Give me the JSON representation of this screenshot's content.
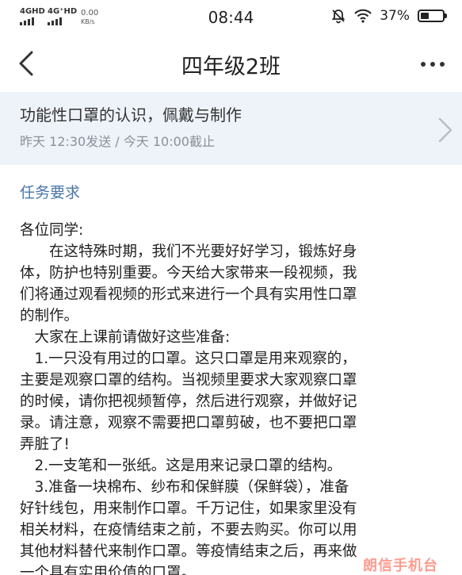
{
  "status_bar": {
    "signal1_label": "4GHD",
    "signal2_label": "4G⁺HD",
    "net_speed_value": "0.00",
    "net_speed_unit": "KB/s",
    "time": "08:44",
    "battery_percent": "37%",
    "battery_level": 0.37
  },
  "nav": {
    "title": "四年级2班"
  },
  "assignment": {
    "title": "功能性口罩的认识，佩戴与制作",
    "time_info": "昨天 12:30发送 / 今天 10:00截止"
  },
  "content": {
    "section_heading": "任务要求",
    "lines": [
      "各位同学:",
      "　　在这特殊时期，我们不光要好好学习，锻炼好身",
      "体，防护也特别重要。今天给大家带来一段视频，我",
      "们将通过观看视频的形式来进行一个具有实用性口罩",
      "的制作。",
      "　大家在上课前请做好这些准备:",
      "　1.一只没有用过的口罩。这只口罩是用来观察的，",
      "主要是观察口罩的结构。当视频里要求大家观察口罩",
      "的时候，请你把视频暂停，然后进行观察，并做好记",
      "录。请注意，观察不需要把口罩剪破，也不要把口罩",
      "弄脏了!",
      "　2.一支笔和一张纸。这是用来记录口罩的结构。",
      "　3.准备一块棉布、纱布和保鲜膜（保鲜袋），准备",
      "好针线包，用来制作口罩。千万记住，如果家里没有",
      "相关材料，在疫情结束之前，不要去购买。你可以用",
      "其他材料替代来制作口罩。等疫情结束之后，再来做",
      "一个具有实用价值的口罩。"
    ]
  },
  "watermark": "朗信手机台"
}
